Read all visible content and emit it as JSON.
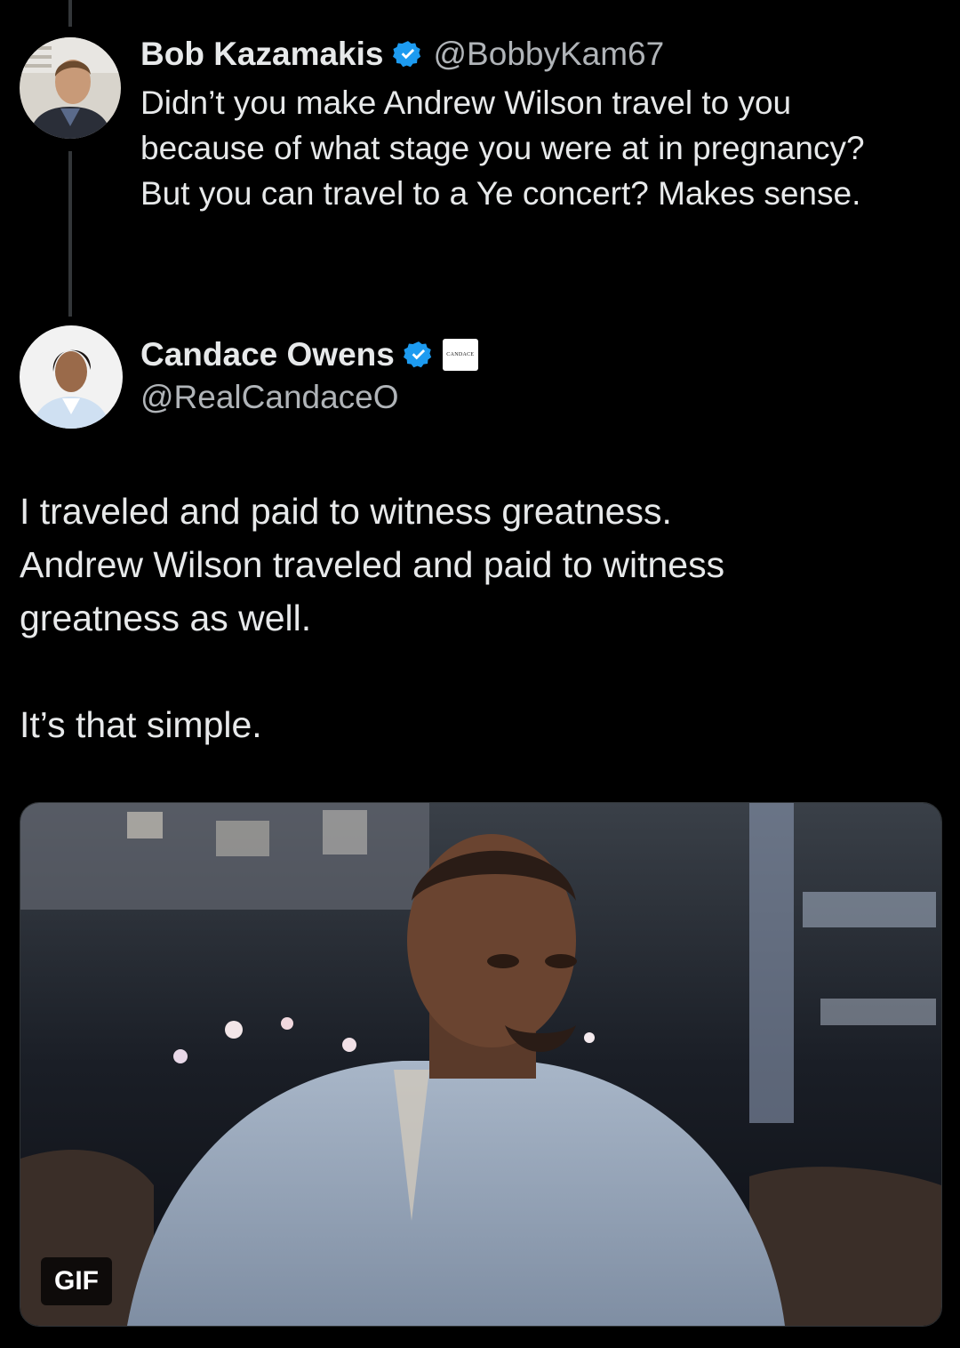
{
  "reply": {
    "author": {
      "display_name": "Bob Kazamakis",
      "handle": "@BobbyKam67",
      "verified": true
    },
    "text_lines": [
      "Didn’t you make Andrew Wilson travel to you",
      "because of what stage you were at in pregnancy?",
      "But you can travel to a Ye concert? Makes sense."
    ]
  },
  "post": {
    "author": {
      "display_name": "Candace Owens",
      "handle": "@RealCandaceO",
      "verified": true,
      "affiliate_badge": "CANDACE"
    },
    "paragraphs": [
      {
        "lines": [
          "I traveled and paid to witness greatness.",
          "Andrew Wilson traveled and paid to witness",
          "greatness as well."
        ]
      },
      {
        "lines": [
          "It’s that simple."
        ]
      }
    ],
    "media": {
      "type": "gif",
      "badge": "GIF"
    }
  },
  "colors": {
    "background": "#000000",
    "text": "#e7e9ea",
    "secondary_text": "#b0b4b8",
    "verified_blue": "#1d9bf0",
    "thread_line": "#333639"
  },
  "icons": {
    "verified": "verified-checkmark-icon"
  }
}
